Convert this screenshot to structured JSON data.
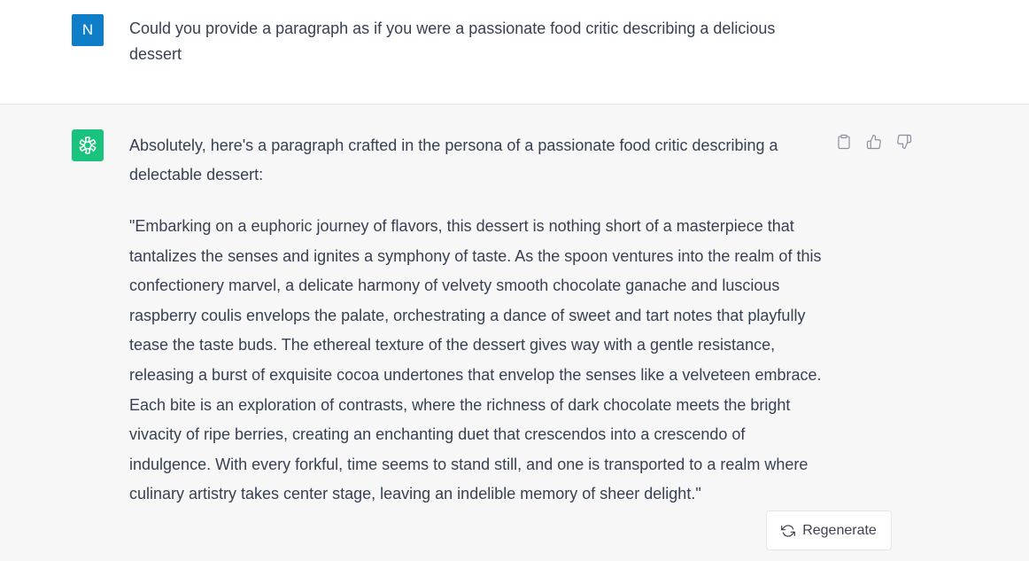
{
  "user": {
    "avatar_initial": "N",
    "message": "Could you provide a paragraph as if you were a passionate food critic describing a delicious dessert"
  },
  "assistant": {
    "intro": "Absolutely, here's a paragraph crafted in the persona of a passionate food critic describing a delectable dessert:",
    "paragraph": "\"Embarking on a euphoric journey of flavors, this dessert is nothing short of a masterpiece that tantalizes the senses and ignites a symphony of taste. As the spoon ventures into the realm of this confectionery marvel, a delicate harmony of velvety smooth chocolate ganache and luscious raspberry coulis envelops the palate, orchestrating a dance of sweet and tart notes that playfully tease the taste buds. The ethereal texture of the dessert gives way with a gentle resistance, releasing a burst of exquisite cocoa undertones that envelop the senses like a velveteen embrace. Each bite is an exploration of contrasts, where the richness of dark chocolate meets the bright vivacity of ripe berries, creating an enchanting duet that crescendos into a crescendo of indulgence. With every forkful, time seems to stand still, and one is transported to a realm where culinary artistry takes center stage, leaving an indelible memory of sheer delight.\""
  },
  "actions": {
    "regenerate_label": "Regenerate",
    "icons": [
      "clipboard-icon",
      "thumbs-up-icon",
      "thumbs-down-icon",
      "refresh-icon"
    ]
  },
  "colors": {
    "user_avatar": "#0f7ec8",
    "assistant_avatar": "#19c37d",
    "assistant_bg": "#f7f7f8",
    "text": "#374151"
  }
}
